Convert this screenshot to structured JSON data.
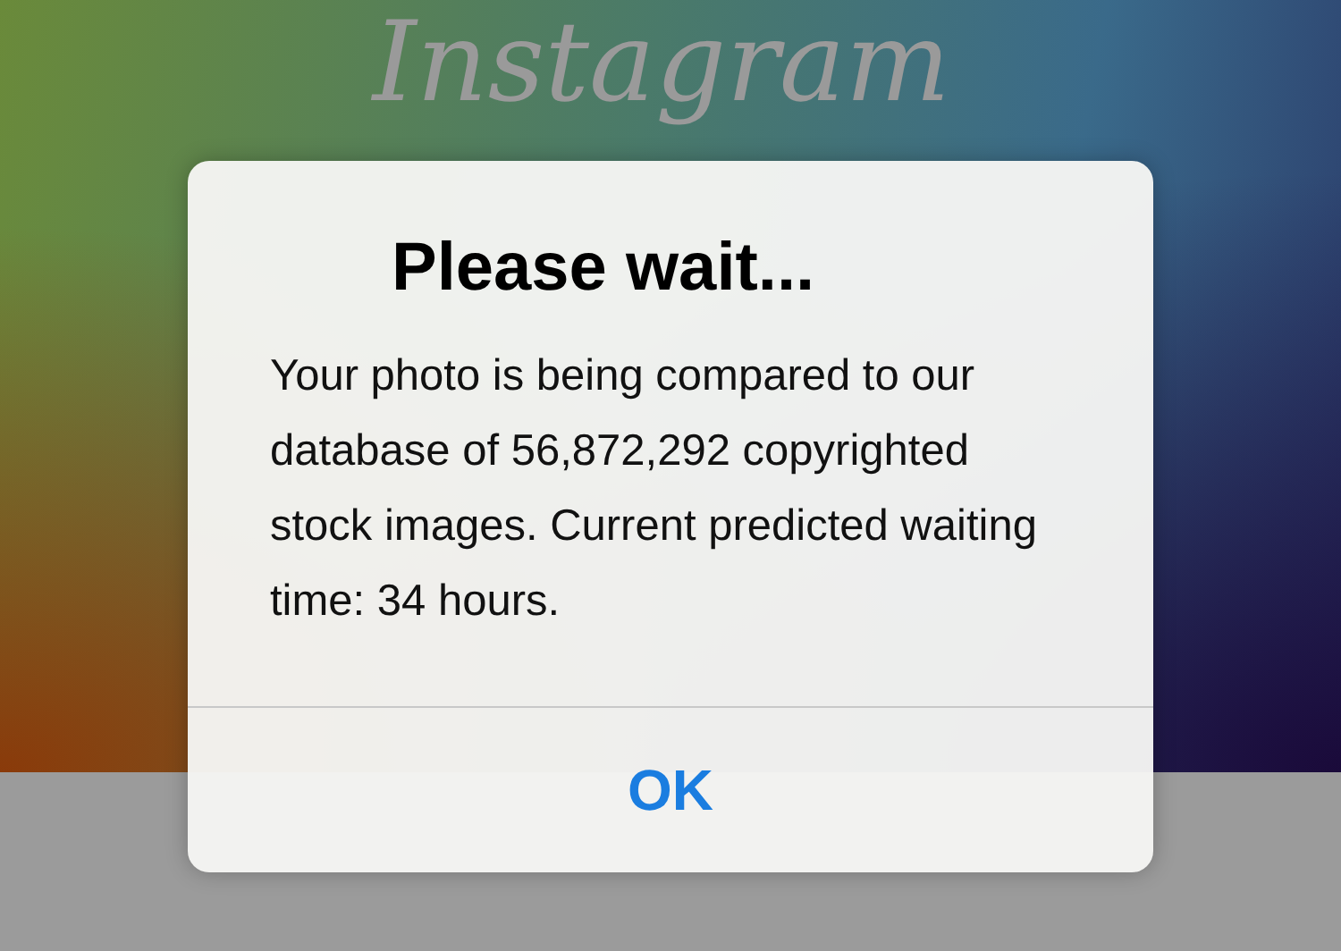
{
  "app": {
    "logo": "Instagram"
  },
  "alert": {
    "title": "Please wait...",
    "message": "Your photo is being compared to our database of 56,872,292 copyrighted stock images. Current predicted waiting time: 34 hours.",
    "buttons": [
      "OK"
    ]
  }
}
